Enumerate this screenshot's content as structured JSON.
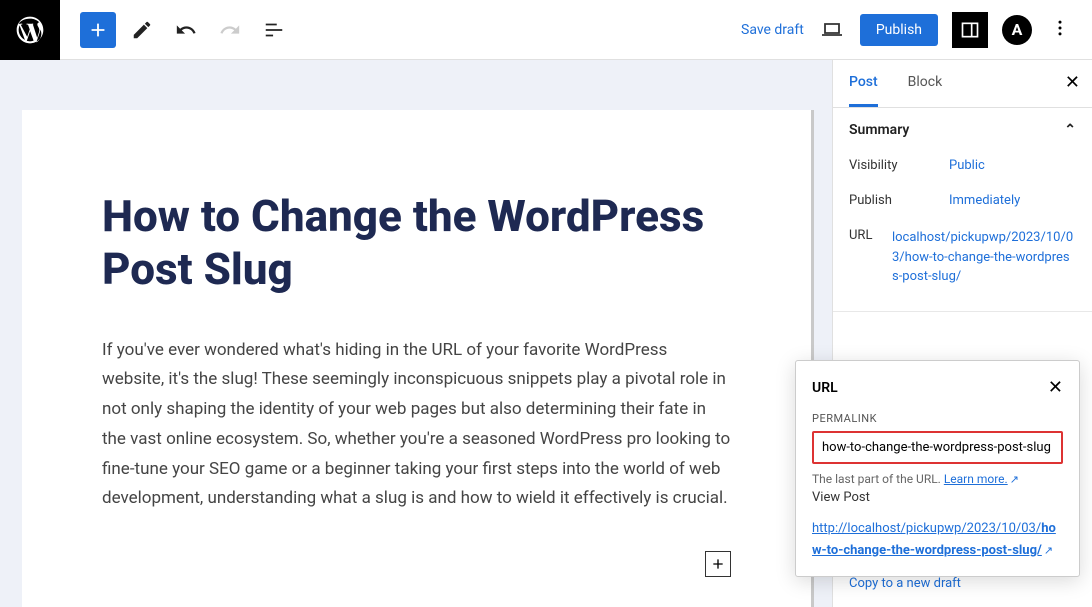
{
  "toolbar": {
    "save_draft": "Save draft",
    "publish": "Publish",
    "a_logo": "A"
  },
  "post": {
    "title": "How to Change the WordPress Post Slug",
    "body": "If you've ever wondered what's hiding in the URL of your favorite WordPress website, it's the slug! These seemingly inconspicuous snippets play a pivotal role in not only shaping the identity of your web pages but also determining their fate in the vast online ecosystem. So, whether you're a seasoned WordPress pro looking to fine-tune your SEO game or a beginner taking your first steps into the world of web development, understanding what a slug is and how to wield it effectively is crucial."
  },
  "sidebar": {
    "tabs": {
      "post": "Post",
      "block": "Block"
    },
    "summary": {
      "title": "Summary",
      "visibility_label": "Visibility",
      "visibility_value": "Public",
      "publish_label": "Publish",
      "publish_value": "Immediately",
      "url_label": "URL",
      "url_value": "localhost/pickupwp/2023/10/03/how-to-change-the-wordpress-post-slug/"
    },
    "copy_draft": "Copy to a new draft"
  },
  "popup": {
    "title": "URL",
    "permalink_label": "PERMALINK",
    "slug_value": "how-to-change-the-wordpress-post-slug",
    "help_prefix": "The last part of the URL. ",
    "learn_more": "Learn more.",
    "view_post": "View Post",
    "full_url_prefix": "http://localhost/pickupwp/2023/10/03/",
    "full_url_bold": "how-to-change-the-wordpress-post-slug/"
  }
}
